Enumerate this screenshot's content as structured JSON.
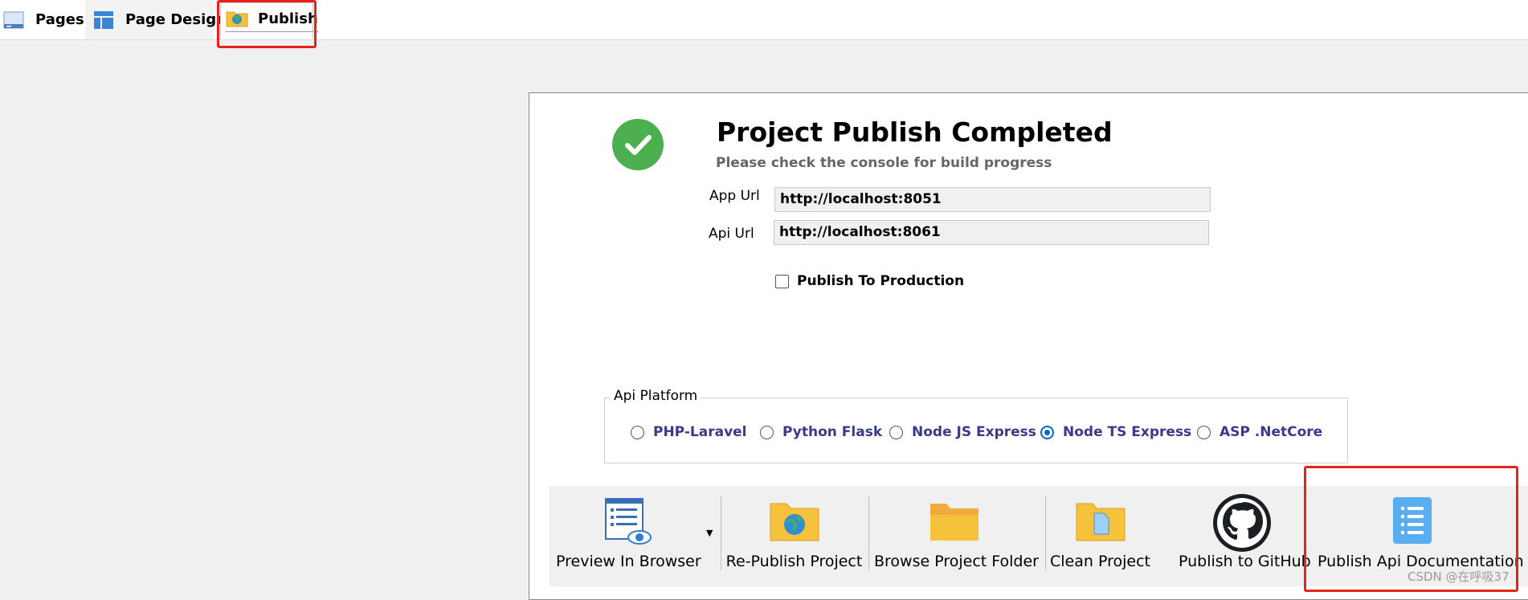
{
  "tabs": [
    {
      "label": "Pages",
      "icon": "pages-icon"
    },
    {
      "label": "Page Design",
      "icon": "page-design-icon"
    },
    {
      "label": "Publish",
      "icon": "publish-globe-icon",
      "active": true
    }
  ],
  "publish": {
    "title": "Project Publish Completed",
    "subtitle": "Please check the console for build progress",
    "app_url_label": "App Url",
    "app_url_value": "http://localhost:8051",
    "api_url_label": "Api Url",
    "api_url_value": "http://localhost:8061",
    "production_label": "Publish To Production",
    "production_checked": false
  },
  "api_platform": {
    "legend": "Api Platform",
    "options": [
      {
        "label": "PHP-Laravel",
        "selected": false
      },
      {
        "label": "Python Flask",
        "selected": false
      },
      {
        "label": "Node JS Express",
        "selected": false
      },
      {
        "label": "Node TS Express",
        "selected": true
      },
      {
        "label": "ASP .NetCore",
        "selected": false
      }
    ]
  },
  "toolbar": {
    "buttons": [
      {
        "label": "Preview In Browser",
        "icon": "preview-browser-icon"
      },
      {
        "label": "Re-Publish Project",
        "icon": "republish-folder-icon"
      },
      {
        "label": "Browse Project Folder",
        "icon": "folder-icon"
      },
      {
        "label": "Clean Project",
        "icon": "clean-folder-icon"
      },
      {
        "label": "Publish to GitHub",
        "icon": "github-icon"
      },
      {
        "label": "Publish Api Documentation",
        "icon": "api-docs-icon"
      }
    ]
  },
  "watermark": "CSDN @在呼吸37",
  "colors": {
    "highlight": "#e8221b",
    "success": "#4caf50",
    "radio_selected": "#0a64c8",
    "folder": "#f7c23b"
  }
}
